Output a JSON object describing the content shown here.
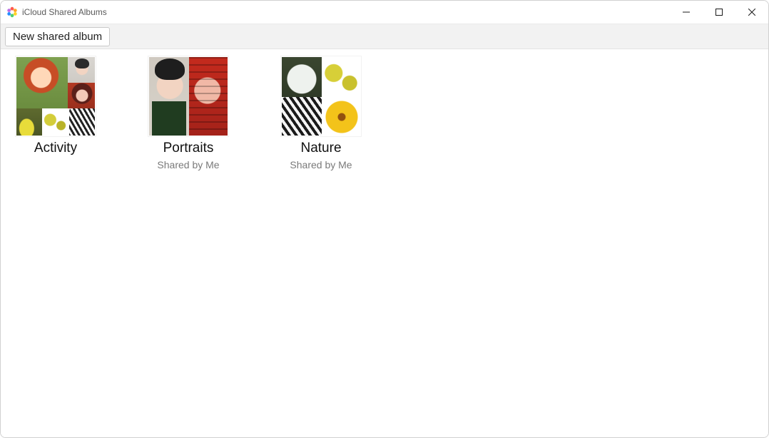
{
  "window": {
    "title": "iCloud Shared Albums"
  },
  "toolbar": {
    "new_album_label": "New shared album"
  },
  "albums": [
    {
      "title": "Activity",
      "subtitle": ""
    },
    {
      "title": "Portraits",
      "subtitle": "Shared by Me"
    },
    {
      "title": "Nature",
      "subtitle": "Shared by Me"
    }
  ]
}
